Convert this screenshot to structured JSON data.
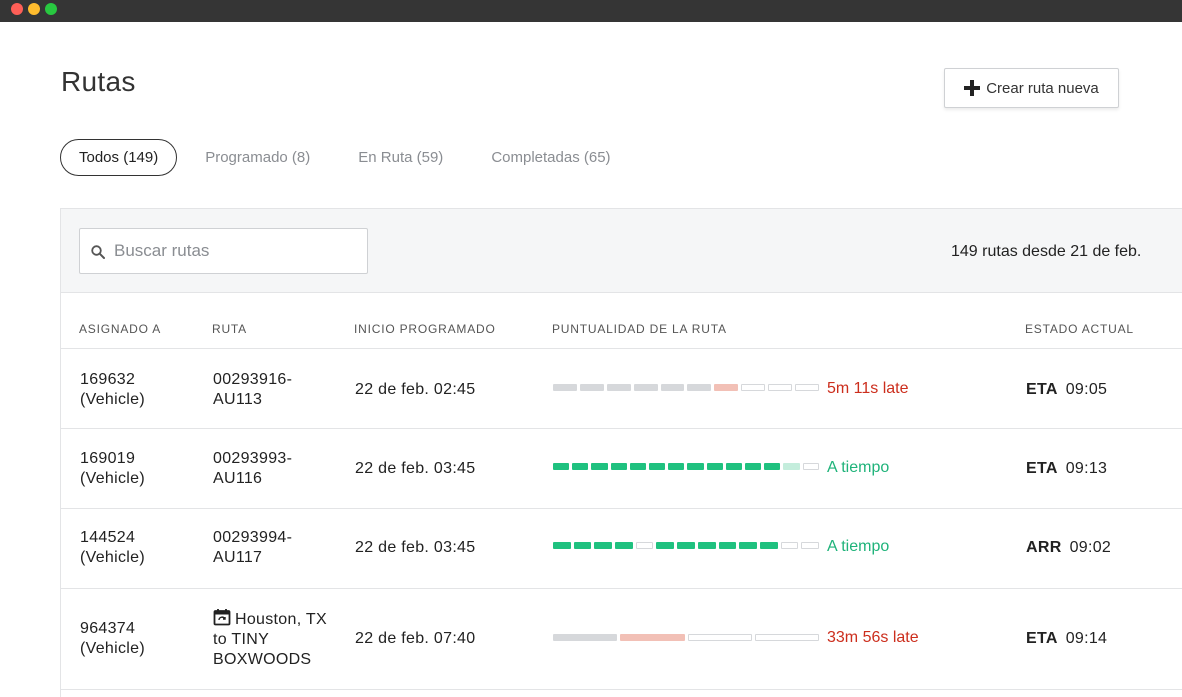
{
  "window": {
    "controls": [
      "close",
      "minimize",
      "maximize"
    ]
  },
  "header": {
    "title": "Rutas",
    "create_button": "Crear ruta nueva",
    "create_icon": "plus-icon"
  },
  "tabs": [
    {
      "label": "Todos (149)",
      "active": true
    },
    {
      "label": "Programado (8)",
      "active": false
    },
    {
      "label": "En Ruta (59)",
      "active": false
    },
    {
      "label": "Completadas (65)",
      "active": false
    }
  ],
  "search": {
    "placeholder": "Buscar rutas",
    "value": "",
    "icon": "search-icon"
  },
  "summary": "149 rutas desde 21 de feb.",
  "columns": [
    "ASIGNADO A",
    "RUTA",
    "INICIO PROGRAMADO",
    "PUNTUALIDAD DE LA RUTA",
    "ESTADO ACTUAL"
  ],
  "rows": [
    {
      "assigned_id": "169632",
      "assigned_type": "(Vehicle)",
      "route_line1": "00293916-",
      "route_line2": "AU113",
      "start": "22 de feb. 02:45",
      "punctuality": "5m 11s late",
      "punctuality_status": "late",
      "progress_segments": [
        "gray",
        "gray",
        "gray",
        "gray",
        "gray",
        "gray",
        "pink",
        "empty",
        "empty",
        "empty"
      ],
      "status_code": "ETA",
      "status_time": "09:05"
    },
    {
      "assigned_id": "169019",
      "assigned_type": "(Vehicle)",
      "route_line1": "00293993-",
      "route_line2": "AU116",
      "start": "22 de feb. 03:45",
      "punctuality": "A tiempo",
      "punctuality_status": "on_time",
      "progress_segments": [
        "green",
        "green",
        "green",
        "green",
        "green",
        "green",
        "green",
        "green",
        "green",
        "green",
        "green",
        "green",
        "lgreen",
        "empty"
      ],
      "status_code": "ETA",
      "status_time": "09:13"
    },
    {
      "assigned_id": "144524",
      "assigned_type": "(Vehicle)",
      "route_line1": "00293994-",
      "route_line2": "AU117",
      "start": "22 de feb. 03:45",
      "punctuality": "A tiempo",
      "punctuality_status": "on_time",
      "progress_segments": [
        "green",
        "green",
        "green",
        "green",
        "empty",
        "green",
        "green",
        "green",
        "green",
        "green",
        "green",
        "empty",
        "empty"
      ],
      "status_code": "ARR",
      "status_time": "09:02"
    },
    {
      "assigned_id": "964374",
      "assigned_type": "(Vehicle)",
      "route_line1": "Houston, TX",
      "route_line2": "to TINY",
      "route_line3": "BOXWOODS",
      "route_icon": "calendar-repeat-icon",
      "start": "22 de feb. 07:40",
      "punctuality": "33m 56s late",
      "punctuality_status": "late",
      "progress_segments": [
        "gray",
        "pink",
        "empty",
        "empty"
      ],
      "status_code": "ETA",
      "status_time": "09:14"
    }
  ],
  "colors": {
    "late": "#cc2e1d",
    "on_time": "#1fb37a",
    "segment_done": "#d6d8db",
    "segment_late": "#f2c0b6",
    "segment_on_time": "#1fc17f",
    "segment_current": "#c4eddc"
  }
}
